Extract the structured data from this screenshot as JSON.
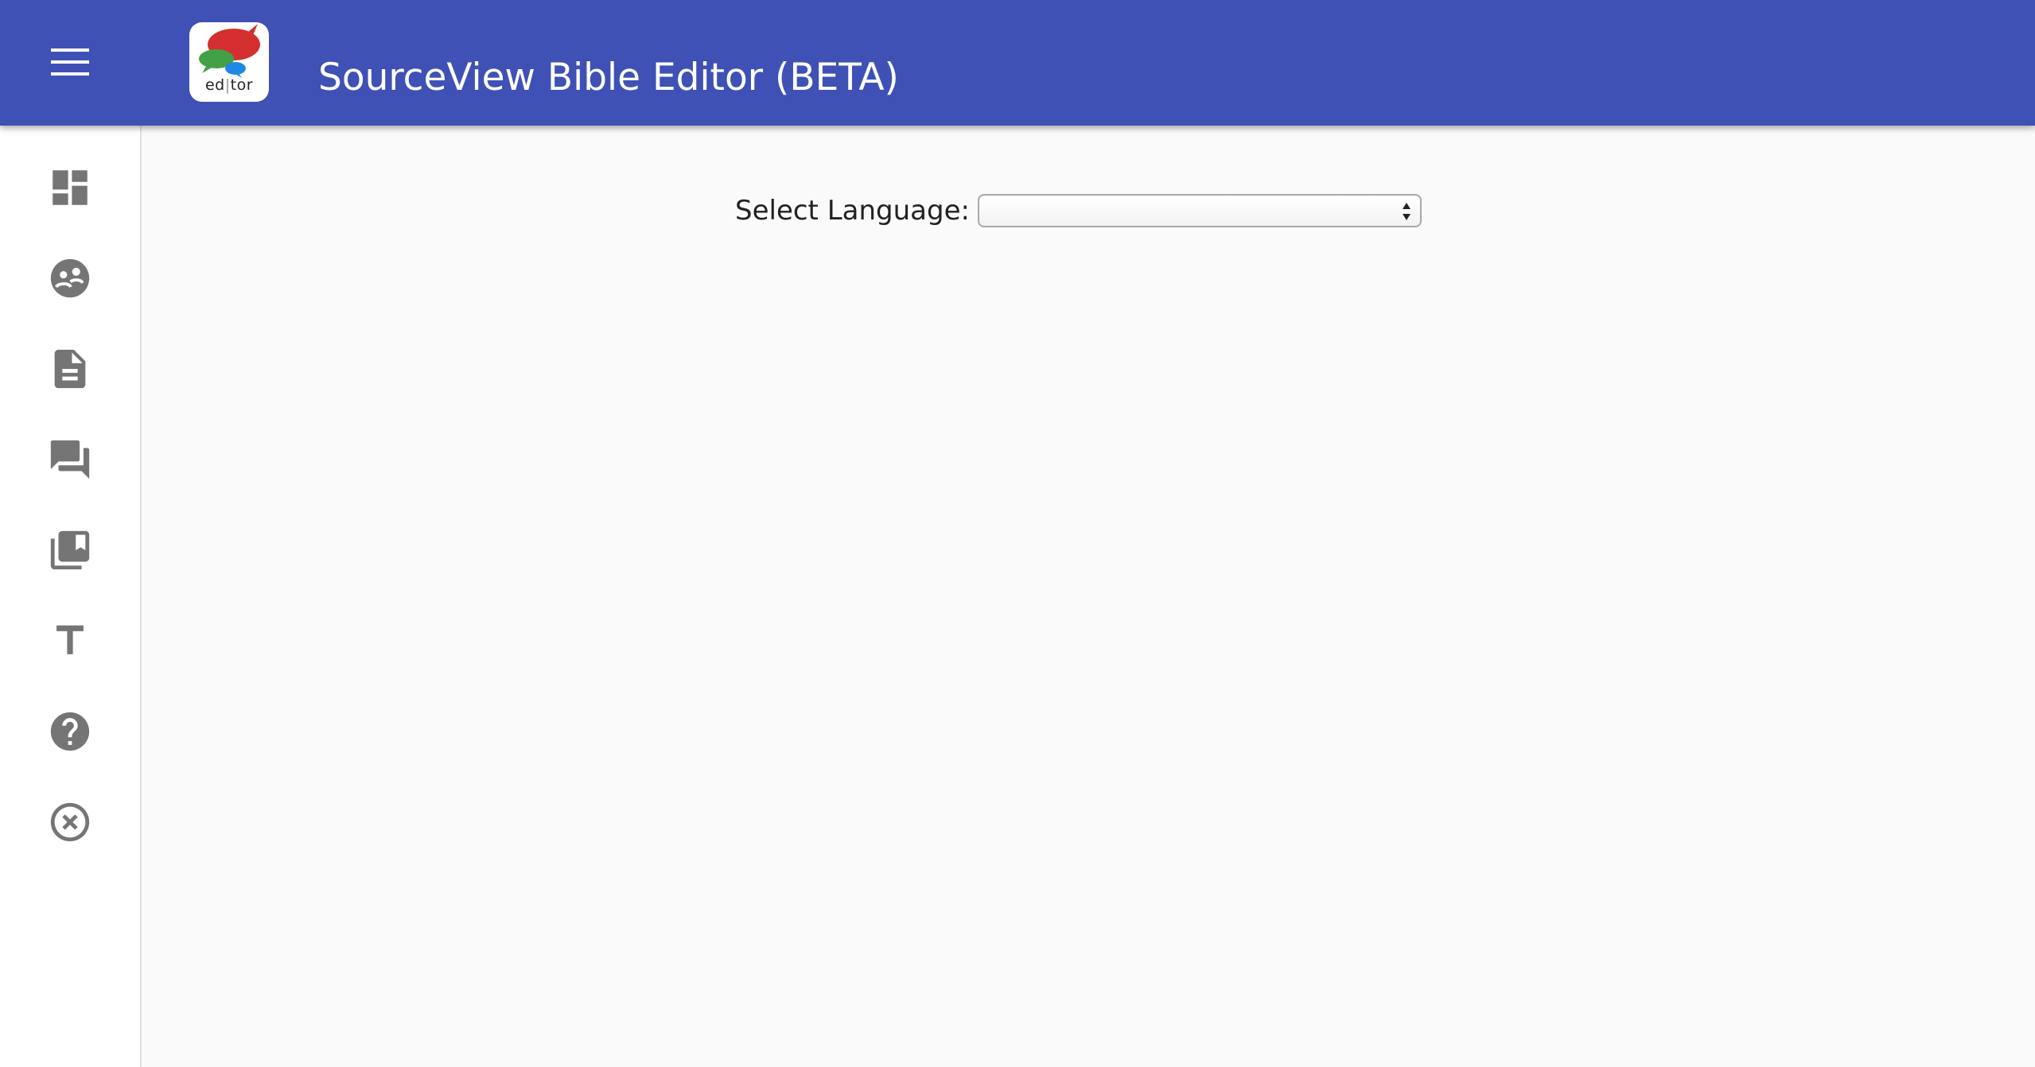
{
  "header": {
    "title": "SourceView Bible Editor (",
    "title_beta": "BETA",
    "title_end": ")",
    "menu_icon": "menu-icon",
    "logo": {
      "text_left": "ed",
      "text_right": "tor",
      "colors": [
        "#d32f2f",
        "#2e7d32",
        "#1e88e5"
      ]
    }
  },
  "colors": {
    "appbar": "#3f51b5",
    "sidebar_icon": "#757575",
    "background": "#fafafa"
  },
  "sidebar": {
    "items": [
      {
        "icon": "dashboard-icon"
      },
      {
        "icon": "people-icon"
      },
      {
        "icon": "document-icon"
      },
      {
        "icon": "chat-icon"
      },
      {
        "icon": "library-books-icon"
      },
      {
        "icon": "text-format-icon"
      },
      {
        "icon": "help-icon"
      },
      {
        "icon": "close-circle-icon"
      }
    ]
  },
  "main": {
    "language_label": "Select Language:",
    "language_selected": ""
  }
}
